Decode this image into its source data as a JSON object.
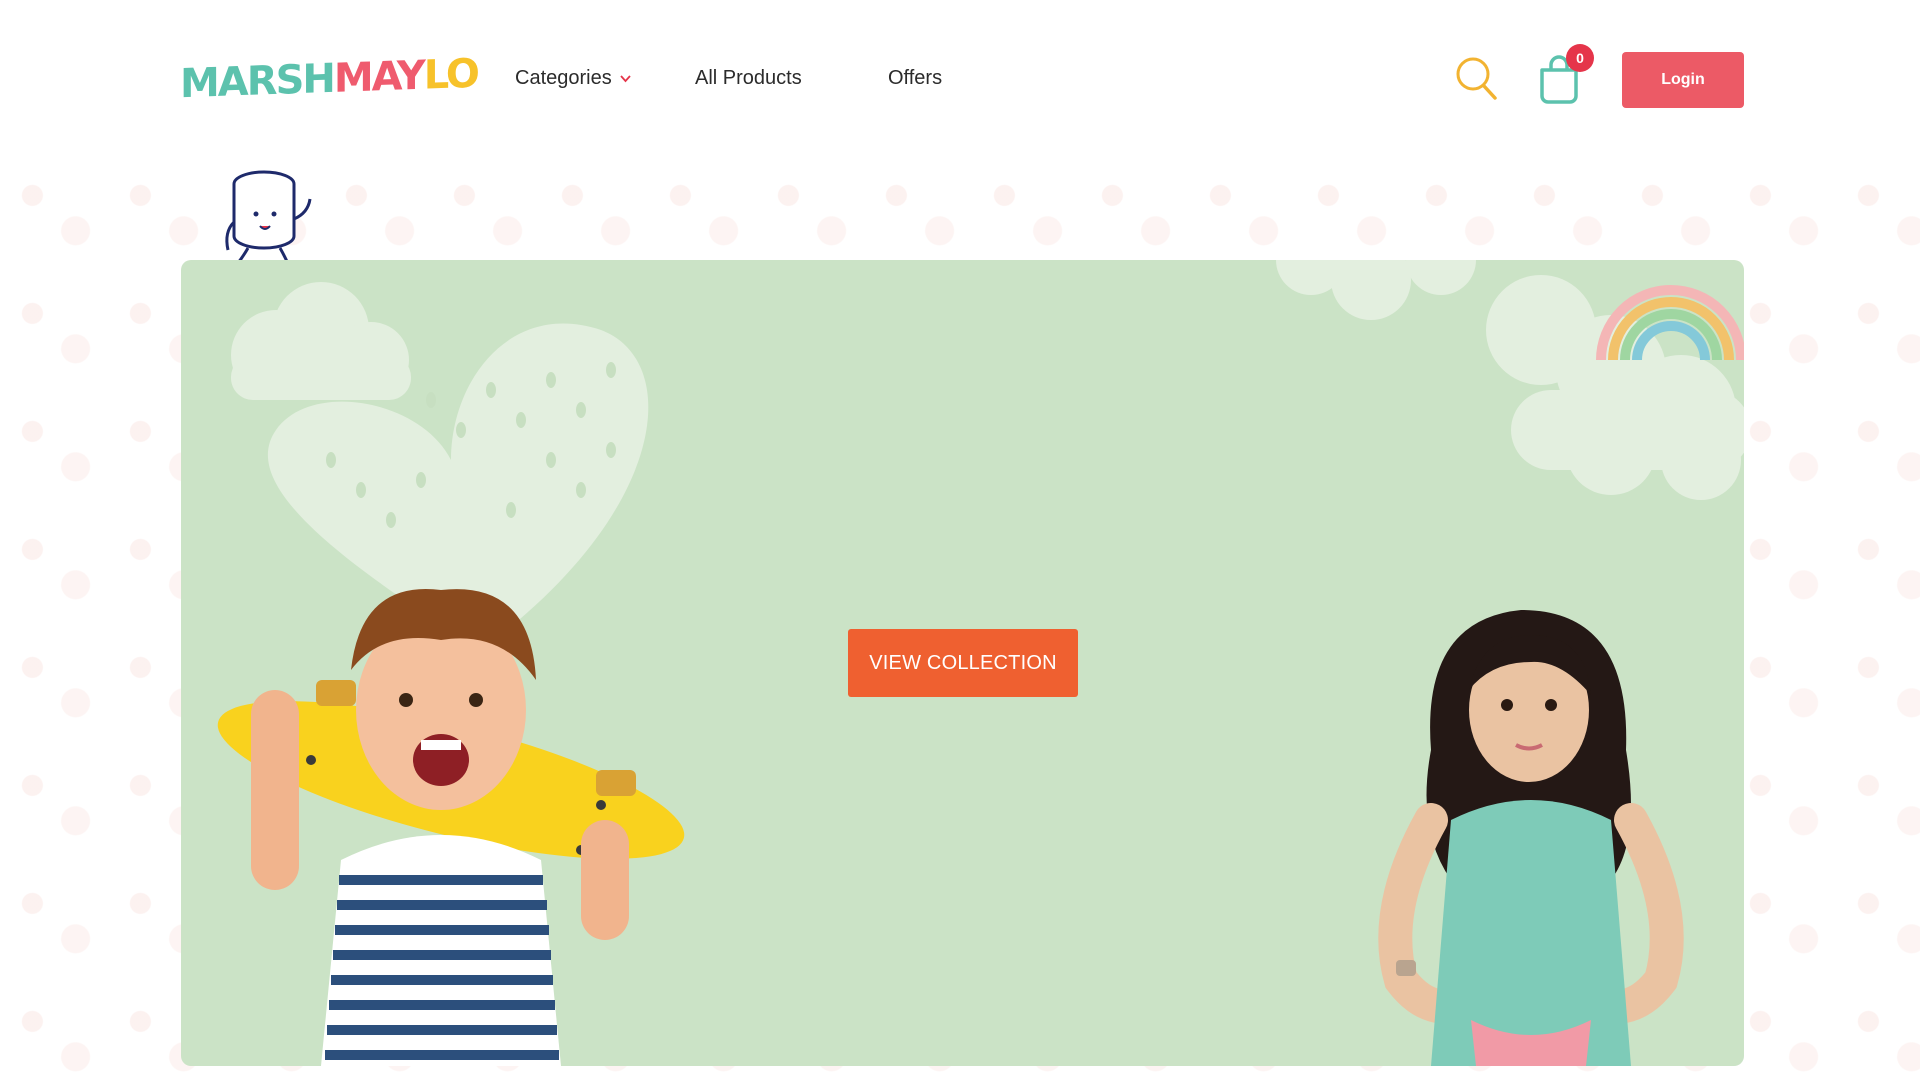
{
  "header": {
    "logo_text_1": "MARSH",
    "logo_text_2": "MAY",
    "logo_text_3": "LO",
    "logo_alt": "MARSHMAYLO",
    "nav": {
      "categories": "Categories",
      "all_products": "All Products",
      "offers": "Offers"
    },
    "cart_count": "0",
    "login_label": "Login"
  },
  "hero": {
    "cta_label": "VIEW COLLECTION",
    "background_color": "#cbe3c6"
  },
  "icons": {
    "search": "search-icon",
    "cart": "shopping-bag-icon",
    "chevron": "chevron-down-icon",
    "mascot": "marshmallow-mascot-icon"
  },
  "colors": {
    "brand_teal": "#5cc2ad",
    "brand_pink": "#ef5b6e",
    "brand_yellow": "#f7c22a",
    "login_button": "#ec5a66",
    "cta_button": "#ef6030",
    "badge": "#e5354a"
  }
}
